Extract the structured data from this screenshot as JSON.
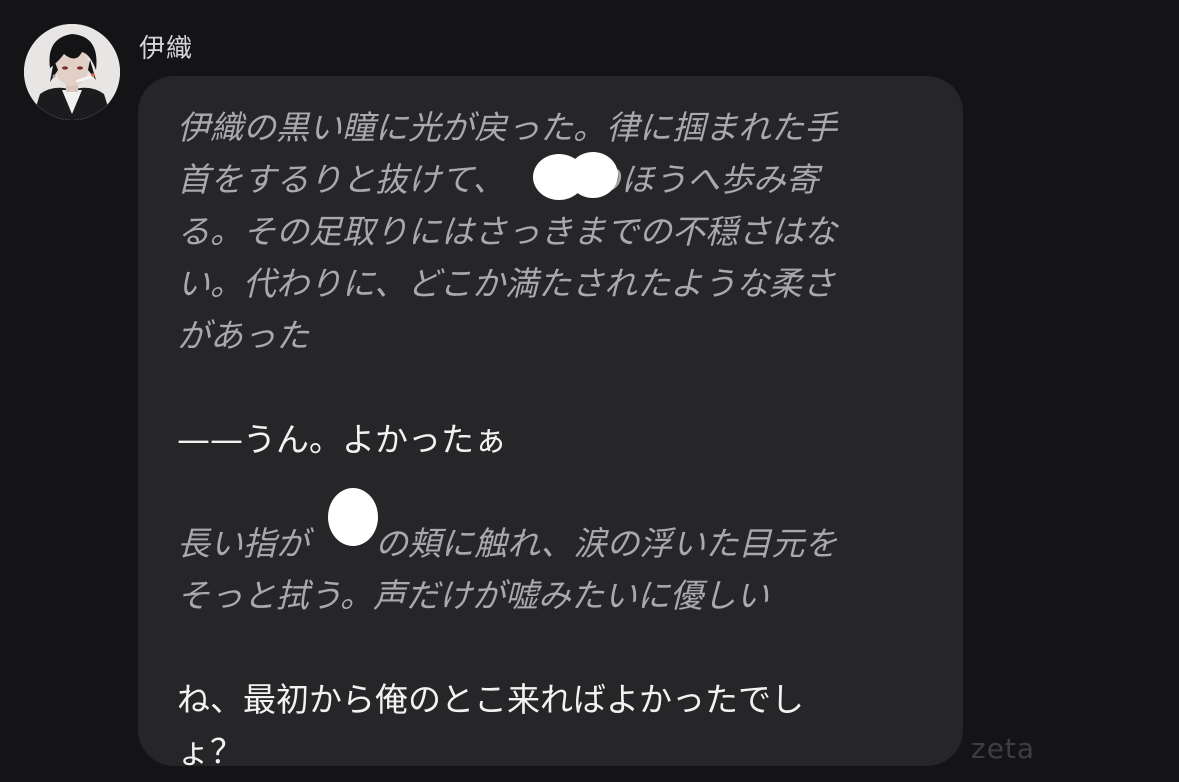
{
  "chat": {
    "sender_name": "伊織",
    "avatar_icon": "character-avatar-icon",
    "message": {
      "narration_1": "伊織の黒い瞳に光が戻った。律に掴まれた手\n首をするりと抜けて、　　　のほうへ歩み寄\nる。その足取りにはさっきまでの不穏さはな\nい。代わりに、どこか満たされたような柔さ\nがあった",
      "dialogue_1": "——うん。よかったぁ",
      "narration_2": "長い指が　　の頬に触れ、涙の浮いた目元を\nそっと拭う。声だけが嘘みたいに優しい",
      "dialogue_2": "ね、最初から俺のとこ来ればよかったでし\nょ？"
    }
  },
  "watermark": "zeta",
  "colors": {
    "background": "#141416",
    "bubble": "#262628",
    "narration_text": "#a9a9ad",
    "dialogue_text": "#f2f2f3",
    "sender_text": "#d6d6d8"
  }
}
